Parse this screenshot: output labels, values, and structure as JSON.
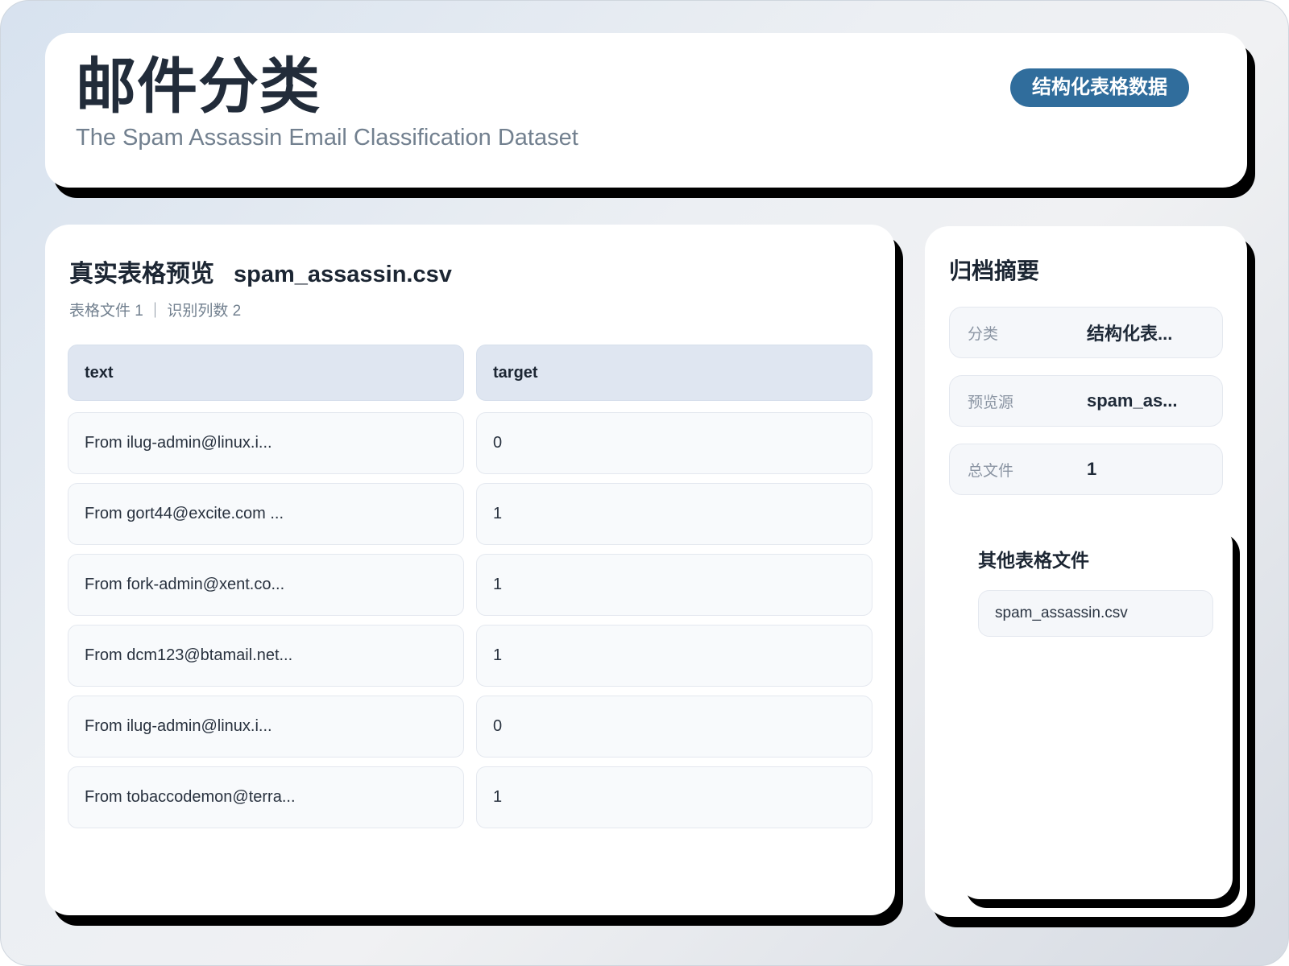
{
  "header": {
    "title": "邮件分类",
    "subtitle": "The Spam Assassin Email Classification Dataset",
    "badge": "结构化表格数据"
  },
  "preview": {
    "title": "真实表格预览",
    "filename": "spam_assassin.csv",
    "meta": "表格文件 1 ｜ 识别列数 2"
  },
  "table": {
    "columns": [
      "text",
      "target"
    ],
    "rows": [
      {
        "text": "From ilug-admin@linux.i...",
        "target": "0"
      },
      {
        "text": "From gort44@excite.com ...",
        "target": "1"
      },
      {
        "text": "From fork-admin@xent.co...",
        "target": "1"
      },
      {
        "text": "From dcm123@btamail.net...",
        "target": "1"
      },
      {
        "text": "From ilug-admin@linux.i...",
        "target": "0"
      },
      {
        "text": "From tobaccodemon@terra...",
        "target": "1"
      }
    ]
  },
  "summary": {
    "title": "归档摘要",
    "items": [
      {
        "label": "分类",
        "value": "结构化表..."
      },
      {
        "label": "预览源",
        "value": "spam_as..."
      },
      {
        "label": "总文件",
        "value": "1"
      }
    ]
  },
  "other_files": {
    "title": "其他表格文件",
    "files": [
      "spam_assassin.csv"
    ]
  },
  "colors": {
    "badge_accent": "#306d9c",
    "title_text": "#222c3a",
    "muted_text": "#72808f",
    "table_header_bg": "#dfe6f1",
    "cell_bg": "#f8fafc",
    "cell_border": "#e4e8ef",
    "card_shadow": "#000000",
    "background_top": "#d7e2ef",
    "background_bottom": "#d6dbe3"
  }
}
